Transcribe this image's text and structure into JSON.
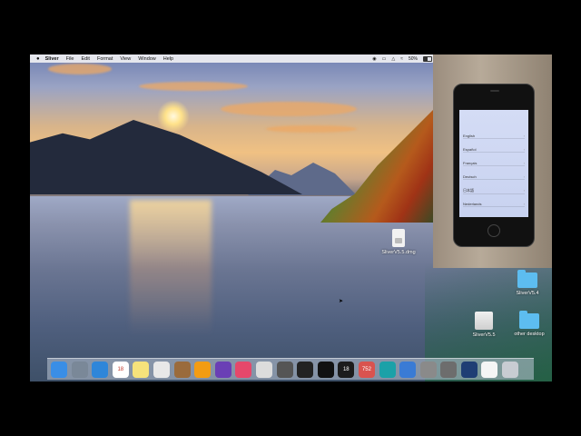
{
  "menubar": {
    "apple": "",
    "app_name": "Sliver",
    "items": [
      "File",
      "Edit",
      "Format",
      "View",
      "Window",
      "Help"
    ],
    "battery": "50%",
    "battery_level": 0.5
  },
  "desktop": {
    "icons": [
      {
        "label": "SliverV5.5.dmg",
        "kind": "dmg"
      },
      {
        "label": "SliverV5.4",
        "kind": "folder"
      },
      {
        "label": "SliverV5.5",
        "kind": "disk"
      },
      {
        "label": "other desktop",
        "kind": "folder"
      }
    ]
  },
  "phone": {
    "languages": [
      "English",
      "Español",
      "Français",
      "Deutsch",
      "日本語",
      "Nederlands"
    ]
  },
  "dock": {
    "apps": [
      {
        "name": "finder-icon",
        "color": "#3a8ee6"
      },
      {
        "name": "launchpad-icon",
        "color": "#7a8898"
      },
      {
        "name": "safari-icon",
        "color": "#2f86d9"
      },
      {
        "name": "calendar-icon",
        "color": "#ffffff",
        "label": "18"
      },
      {
        "name": "notes-icon",
        "color": "#f6e27b"
      },
      {
        "name": "textedit-icon",
        "color": "#e8e8e8"
      },
      {
        "name": "book-icon",
        "color": "#9a6b3c"
      },
      {
        "name": "photos-icon",
        "color": "#f39c12"
      },
      {
        "name": "imovie-icon",
        "color": "#6a3fb5"
      },
      {
        "name": "itunes-icon",
        "color": "#e6486b"
      },
      {
        "name": "script-icon",
        "color": "#dcdcdc"
      },
      {
        "name": "pen-icon",
        "color": "#555555"
      },
      {
        "name": "terminal-icon",
        "color": "#222222"
      },
      {
        "name": "sliver-icon",
        "color": "#111111"
      },
      {
        "name": "weather-icon",
        "color": "#1c1c1c",
        "label": "18"
      },
      {
        "name": "badge-icon",
        "color": "#d9534f",
        "label": "752"
      },
      {
        "name": "arduino-icon",
        "color": "#1ba1a8"
      },
      {
        "name": "icloud-icon",
        "color": "#3a7bd5"
      },
      {
        "name": "disk-utility-icon",
        "color": "#8a8a8a"
      },
      {
        "name": "preferences-icon",
        "color": "#6d6d6d"
      },
      {
        "name": "quicktime-icon",
        "color": "#1f3e74"
      },
      {
        "name": "preview-icon",
        "color": "#f5f5f5"
      },
      {
        "name": "trash-icon",
        "color": "#c8ccd2"
      }
    ]
  }
}
